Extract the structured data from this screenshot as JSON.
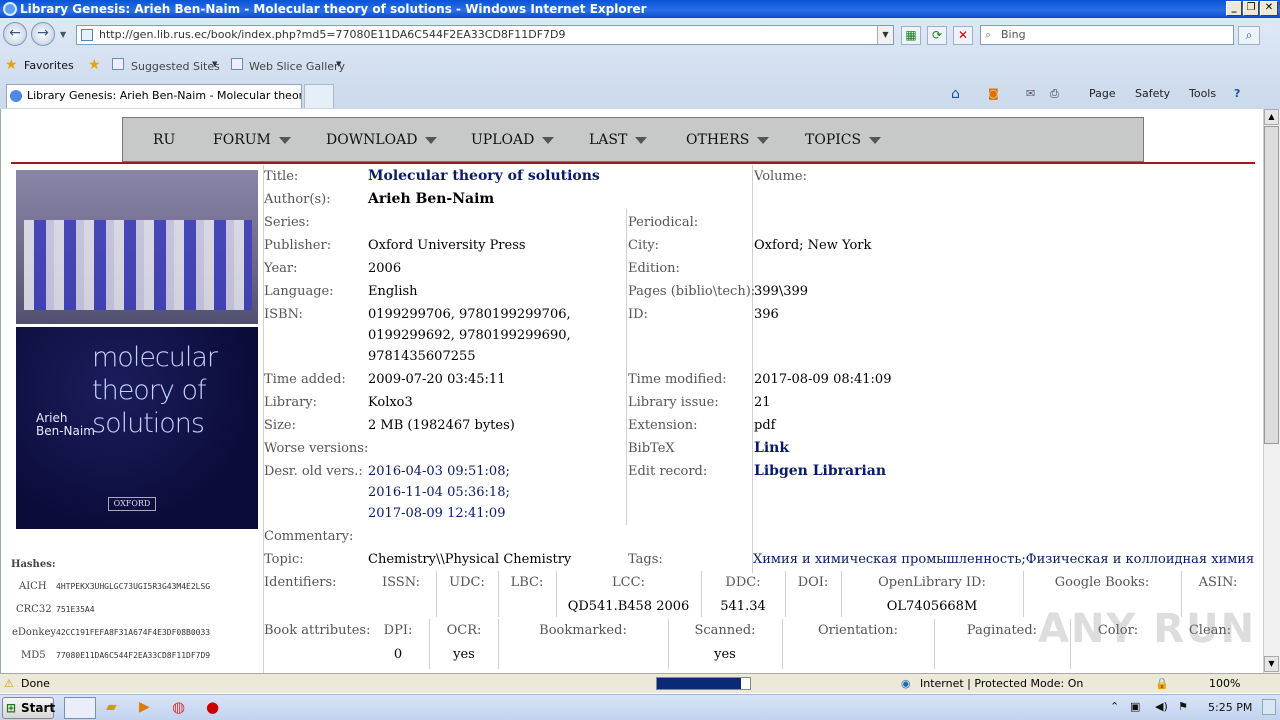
{
  "window": {
    "title": "Library Genesis: Arieh Ben-Naim - Molecular theory of solutions - Windows Internet Explorer"
  },
  "browser": {
    "url": "http://gen.lib.rus.ec/book/index.php?md5=77080E11DA6C544F2EA33CD8F11DF7D9",
    "search_placeholder": "Bing",
    "favorites_label": "Favorites",
    "suggested_sites": "Suggested Sites",
    "web_slice": "Web Slice Gallery",
    "tab_title": "Library Genesis: Arieh Ben-Naim - Molecular theory of ...",
    "cmd": {
      "page": "Page",
      "safety": "Safety",
      "tools": "Tools"
    }
  },
  "site_menu": [
    {
      "label": "RU",
      "dropdown": false
    },
    {
      "label": "FORUM",
      "dropdown": true
    },
    {
      "label": "DOWNLOAD",
      "dropdown": true
    },
    {
      "label": "UPLOAD",
      "dropdown": true
    },
    {
      "label": "LAST",
      "dropdown": true
    },
    {
      "label": "OTHERS",
      "dropdown": true
    },
    {
      "label": "TOPICS",
      "dropdown": true
    }
  ],
  "cover": {
    "title": "molecular theory of solutions",
    "author": "Arieh Ben-Naim",
    "publisher_logo": "OXFORD"
  },
  "book": {
    "labels": {
      "title": "Title:",
      "volume": "Volume:",
      "authors": "Author(s):",
      "series": "Series:",
      "periodical": "Periodical:",
      "publisher": "Publisher:",
      "city": "City:",
      "year": "Year:",
      "edition": "Edition:",
      "language": "Language:",
      "pages": "Pages (biblio\\tech):",
      "isbn": "ISBN:",
      "id": "ID:",
      "time_added": "Time added:",
      "time_modified": "Time modified:",
      "library": "Library:",
      "library_issue": "Library issue:",
      "size": "Size:",
      "extension": "Extension:",
      "worse_versions": "Worse versions:",
      "bibtex": "BibTeX",
      "desr_old": "Desr. old vers.:",
      "edit_record": "Edit record:",
      "commentary": "Commentary:",
      "topic": "Topic:",
      "tags": "Tags:",
      "identifiers": "Identifiers:",
      "book_attributes": "Book attributes:"
    },
    "title": "Molecular theory of solutions",
    "authors": "Arieh Ben-Naim",
    "publisher": "Oxford University Press",
    "city": "Oxford; New York",
    "year": "2006",
    "language": "English",
    "pages": "399\\399",
    "isbn_lines": [
      "0199299706, 9780199299706,",
      "0199299692, 9780199299690,",
      "9781435607255"
    ],
    "id": "396",
    "time_added": "2009-07-20 03:45:11",
    "time_modified": "2017-08-09 08:41:09",
    "library": "Kolxo3",
    "library_issue": "21",
    "size": "2 MB (1982467 bytes)",
    "extension": "pdf",
    "bibtex_link": "Link",
    "desr_old": [
      "2016-04-03 09:51:08;",
      "2016-11-04 05:36:18;",
      "2017-08-09 12:41:09"
    ],
    "edit_record": "Libgen Librarian",
    "topic": "Chemistry\\\\Physical Chemistry",
    "tags": "Химия и химическая промышленность;Физическая и коллоидная химия"
  },
  "identifiers": {
    "headers": [
      "ISSN:",
      "UDC:",
      "LBC:",
      "LCC:",
      "DDC:",
      "DOI:",
      "OpenLibrary ID:",
      "Google Books:",
      "ASIN:"
    ],
    "values": [
      "",
      "",
      "",
      "QD541.B458 2006",
      "541.34",
      "",
      "OL7405668M",
      "",
      ""
    ]
  },
  "attributes": {
    "headers": [
      "DPI:",
      "OCR:",
      "Bookmarked:",
      "Scanned:",
      "Orientation:",
      "Paginated:",
      "Color:",
      "Clean:"
    ],
    "values": [
      "0",
      "yes",
      "",
      "yes",
      "",
      "",
      "",
      ""
    ]
  },
  "hashes": {
    "title": "Hashes:",
    "items": [
      {
        "k": "AICH",
        "v": "4HTPEKX3UHGLGC73UGI5R3G43M4E2LSG"
      },
      {
        "k": "CRC32",
        "v": "751E35A4"
      },
      {
        "k": "eDonkey",
        "v": "42CC191FEFA8F31A674F4E3DF08B0033"
      },
      {
        "k": "MD5",
        "v": "77080E11DA6C544F2EA33CD8F11DF7D9"
      }
    ]
  },
  "statusbar": {
    "text": "Done",
    "zone": "Internet | Protected Mode: On",
    "zoom": "100%",
    "progress": 0.9
  },
  "taskbar": {
    "start": "Start",
    "time": "5:25 PM"
  },
  "watermark": "ANY RUN"
}
